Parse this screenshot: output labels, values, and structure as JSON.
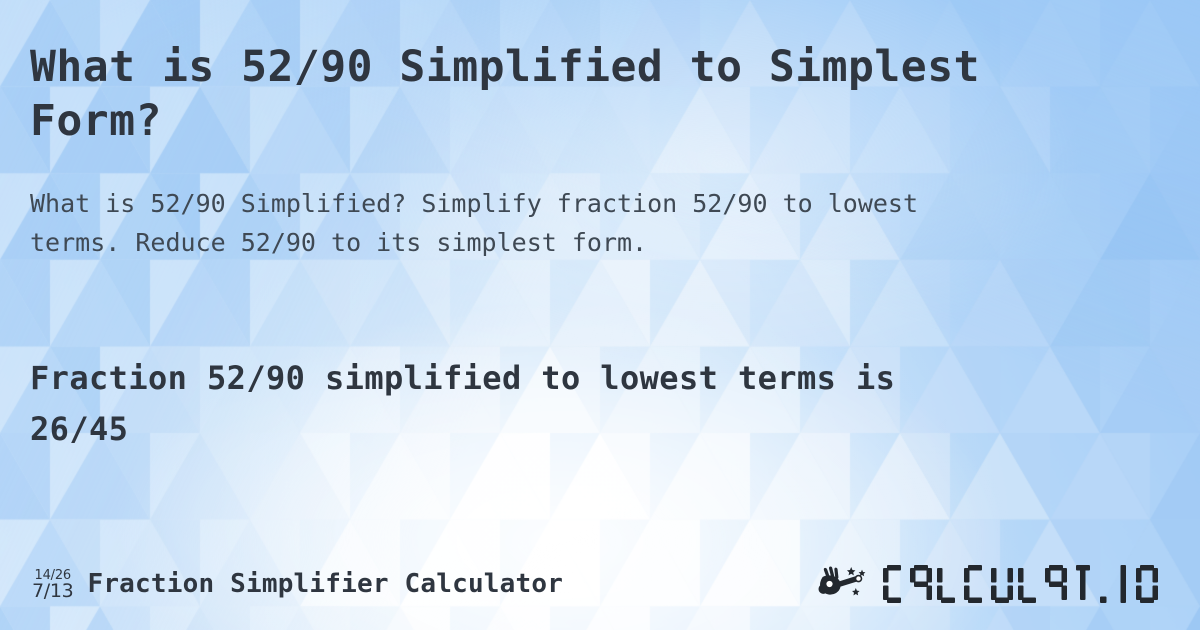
{
  "meta": {
    "accent_color": "#2f3640",
    "background_color": "#cfe4fb",
    "subtitle_color": "#3f4954"
  },
  "header": {
    "title": "What is 52/90 Simplified to Simplest Form?",
    "title_line_1": "What is 52/90 Simplified to Simplest",
    "title_line_2": "Form?"
  },
  "description": {
    "text": "What is 52/90 Simplified? Simplify fraction 52/90 to lowest terms. Reduce 52/90 to its simplest form.",
    "line_1": "What is 52/90 Simplified? Simplify fraction 52/90 to lowest",
    "line_2": "terms. Reduce 52/90 to its simplest form."
  },
  "result": {
    "text": "Fraction 52/90 simplified to lowest terms is 26/45",
    "line_1": "Fraction 52/90 simplified to lowest terms is",
    "line_2": "26/45",
    "input_fraction": "52/90",
    "simplified_fraction": "26/45",
    "numerator": 26,
    "denominator": 45
  },
  "footer": {
    "icon": {
      "name": "fraction-simplify-icon",
      "top": "14/26",
      "bottom": "7/13"
    },
    "title": "Fraction Simplifier Calculator",
    "brand": {
      "wand_icon": "magic-wand-hand-icon",
      "name": "CALCULAT.IO",
      "letters": [
        "C",
        "A",
        "L",
        "C",
        "U",
        "L",
        "A",
        "T",
        ".",
        "I",
        "O"
      ]
    }
  }
}
